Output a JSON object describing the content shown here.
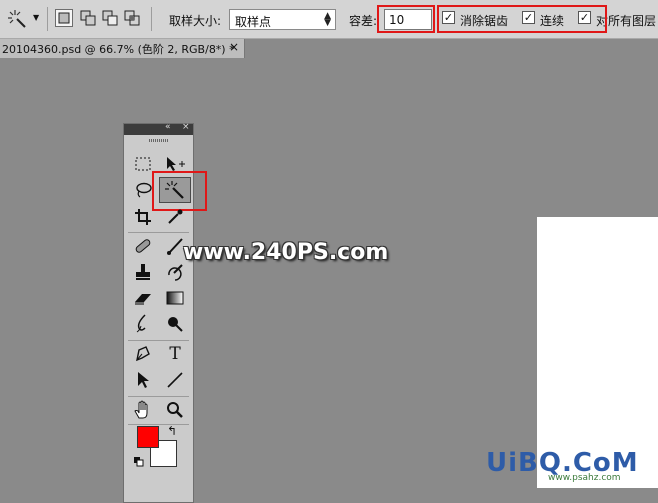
{
  "options_bar": {
    "sample_size_label": "取样大小:",
    "sample_size_value": "取样点",
    "tolerance_label": "容差:",
    "tolerance_value": "10",
    "anti_alias_label": "消除锯齿",
    "contiguous_label": "连续",
    "all_layers_label": "对所有图层",
    "check_mark": "✓"
  },
  "document_tab": {
    "title": "20104360.psd @ 66.7% (色阶 2, RGB/8*) *",
    "close": "×"
  },
  "toolbox": {
    "collapse": "«",
    "close": "×",
    "type_tool_glyph": "T",
    "tools": [
      "rectangular-marquee",
      "move",
      "lasso",
      "magic-wand",
      "crop",
      "eyedropper",
      "spot-healing-brush",
      "brush",
      "clone-stamp",
      "history-brush",
      "eraser",
      "gradient",
      "blur",
      "dodge",
      "pen",
      "type",
      "path-selection",
      "line",
      "hand",
      "zoom"
    ],
    "foreground_color": "#ff0000",
    "background_color": "#ffffff"
  },
  "watermarks": {
    "site1": "www.240PS.com",
    "site2": "UiBQ.CoM",
    "site3": "www.psahz.com"
  }
}
